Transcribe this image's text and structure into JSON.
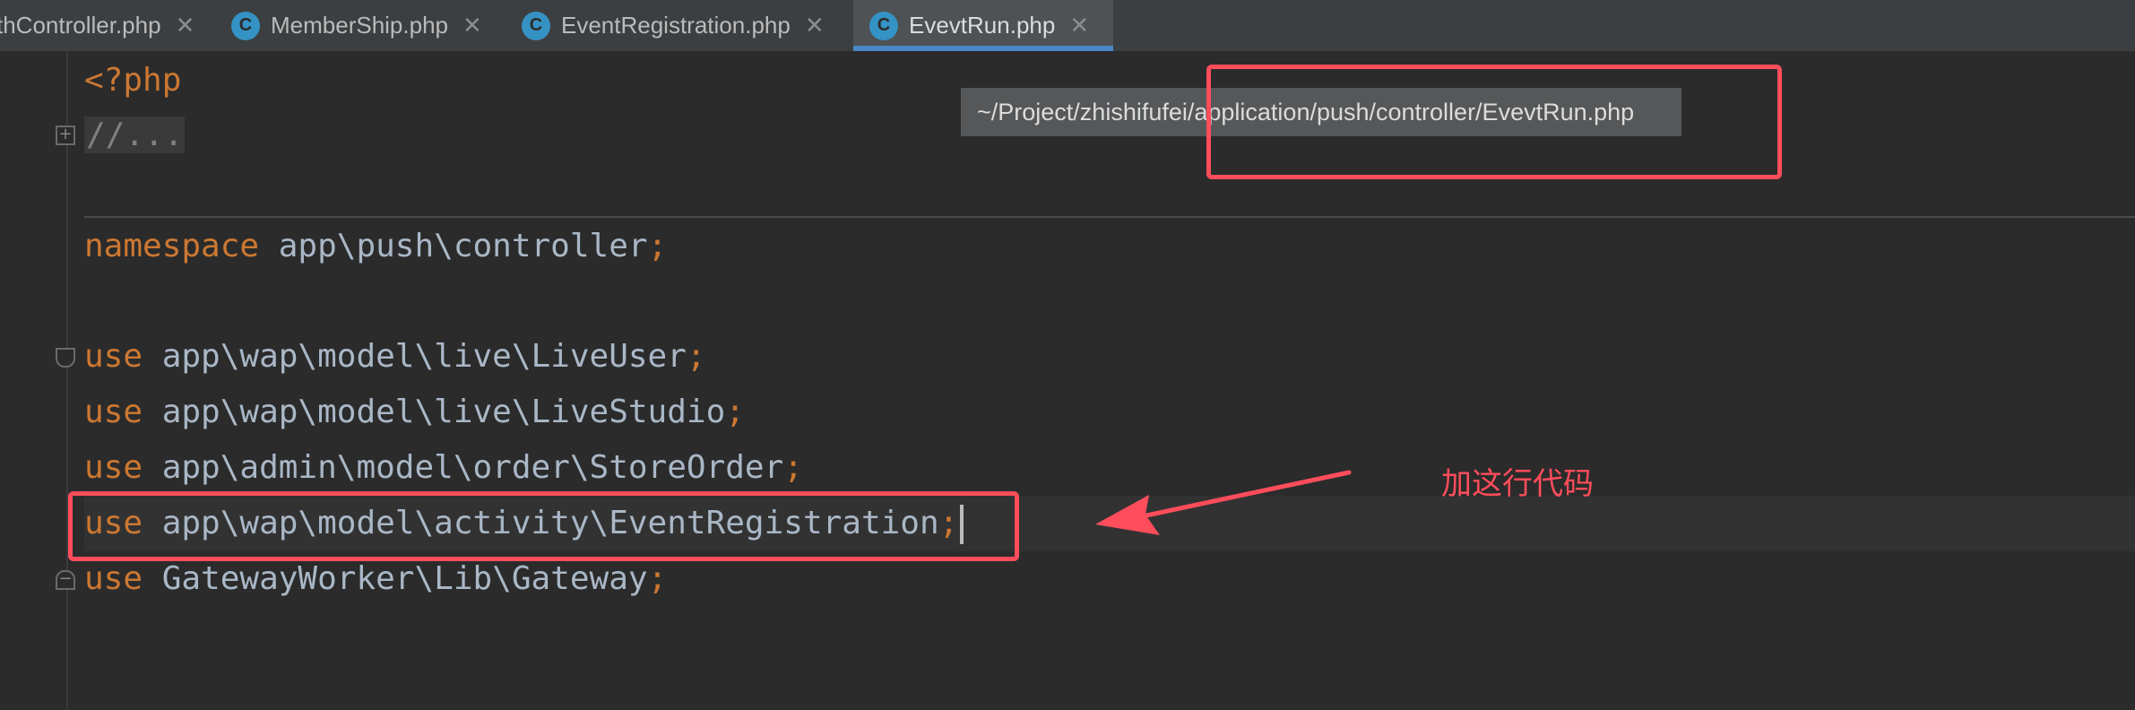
{
  "tabs": [
    {
      "label": "thController.php",
      "icon": null,
      "active": false
    },
    {
      "label": "MemberShip.php",
      "icon": "C",
      "active": false
    },
    {
      "label": "EventRegistration.php",
      "icon": "C",
      "active": false
    },
    {
      "label": "EvevtRun.php",
      "icon": "C",
      "active": true
    }
  ],
  "tooltip": {
    "path": "~/Project/zhishifufei/application/push/controller/EvevtRun.php"
  },
  "code": {
    "line1": "<?php",
    "line2": "//...",
    "line3_kw": "namespace",
    "line3_path": " app\\push\\controller",
    "use_kw": "use",
    "line4_path": " app\\wap\\model\\live\\LiveUser",
    "line5_path": " app\\wap\\model\\live\\LiveStudio",
    "line6_path": " app\\admin\\model\\order\\StoreOrder",
    "line7_path": " app\\wap\\model\\activity\\EventRegistration",
    "line8_path": " GatewayWorker\\Lib\\Gateway",
    "semicolon": ";"
  },
  "annotation": {
    "text": "加这行代码",
    "color": "#ff4d5b"
  },
  "colors": {
    "background": "#2b2b2b",
    "keyword": "#cc7832",
    "text": "#a9b7c6",
    "tab_accent": "#4a88c7"
  }
}
